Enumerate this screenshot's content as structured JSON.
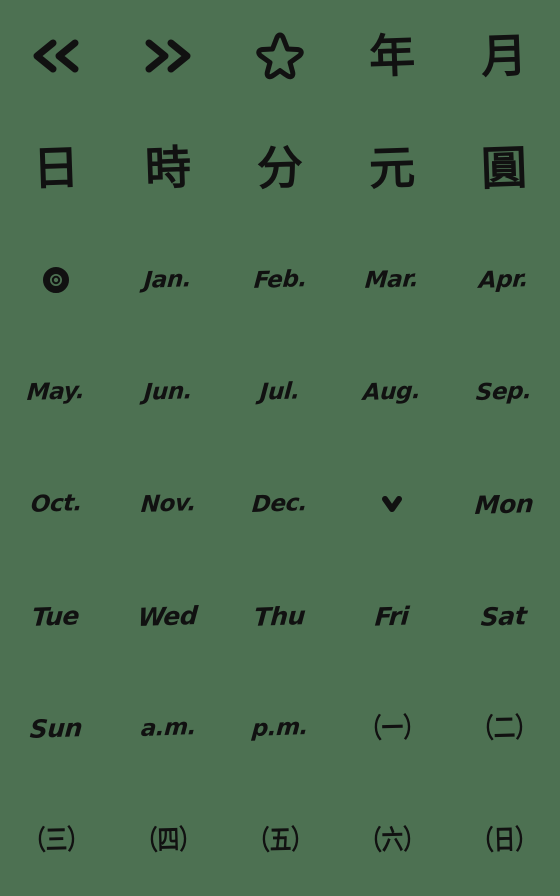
{
  "sheet": {
    "background_color": "#4d7152",
    "ink_color": "#111111",
    "columns": 5,
    "rows": 8
  },
  "items": [
    {
      "name": "double-left-chevron-icon",
      "kind": "icon",
      "icon": "chevron-double-left",
      "label": "<<"
    },
    {
      "name": "double-right-chevron-icon",
      "kind": "icon",
      "icon": "chevron-double-right",
      "label": ">>"
    },
    {
      "name": "star-icon",
      "kind": "icon",
      "icon": "star-outline",
      "label": "☆"
    },
    {
      "name": "kanji-year",
      "kind": "cjk",
      "label": "年"
    },
    {
      "name": "kanji-month",
      "kind": "cjk",
      "label": "月"
    },
    {
      "name": "kanji-day",
      "kind": "cjk",
      "label": "日"
    },
    {
      "name": "kanji-hour",
      "kind": "cjk",
      "label": "時"
    },
    {
      "name": "kanji-minute",
      "kind": "cjk",
      "label": "分"
    },
    {
      "name": "kanji-yuan",
      "kind": "cjk",
      "label": "元"
    },
    {
      "name": "kanji-circled-yen",
      "kind": "cjk",
      "label": "圓"
    },
    {
      "name": "ring-dot-icon",
      "kind": "icon",
      "icon": "ring-dot",
      "label": "◎"
    },
    {
      "name": "month-jan",
      "kind": "latin",
      "label": "Jan."
    },
    {
      "name": "month-feb",
      "kind": "latin",
      "label": "Feb."
    },
    {
      "name": "month-mar",
      "kind": "latin",
      "label": "Mar."
    },
    {
      "name": "month-apr",
      "kind": "latin",
      "label": "Apr."
    },
    {
      "name": "month-may",
      "kind": "latin",
      "label": "May."
    },
    {
      "name": "month-jun",
      "kind": "latin",
      "label": "Jun."
    },
    {
      "name": "month-jul",
      "kind": "latin",
      "label": "Jul."
    },
    {
      "name": "month-aug",
      "kind": "latin",
      "label": "Aug."
    },
    {
      "name": "month-sep",
      "kind": "latin",
      "label": "Sep."
    },
    {
      "name": "month-oct",
      "kind": "latin",
      "label": "Oct."
    },
    {
      "name": "month-nov",
      "kind": "latin",
      "label": "Nov."
    },
    {
      "name": "month-dec",
      "kind": "latin",
      "label": "Dec."
    },
    {
      "name": "chevron-down-icon",
      "kind": "icon",
      "icon": "chevron-down-small",
      "label": "v"
    },
    {
      "name": "weekday-mon",
      "kind": "latin",
      "label": "Mon"
    },
    {
      "name": "weekday-tue",
      "kind": "latin",
      "label": "Tue"
    },
    {
      "name": "weekday-wed",
      "kind": "latin",
      "label": "Wed"
    },
    {
      "name": "weekday-thu",
      "kind": "latin",
      "label": "Thu"
    },
    {
      "name": "weekday-fri",
      "kind": "latin",
      "label": "Fri"
    },
    {
      "name": "weekday-sat",
      "kind": "latin",
      "label": "Sat"
    },
    {
      "name": "weekday-sun",
      "kind": "latin",
      "label": "Sun"
    },
    {
      "name": "time-am",
      "kind": "latin",
      "label": "a.m."
    },
    {
      "name": "time-pm",
      "kind": "latin",
      "label": "p.m."
    },
    {
      "name": "weekday-cjk-one",
      "kind": "paren",
      "label": "（一）"
    },
    {
      "name": "weekday-cjk-two",
      "kind": "paren",
      "label": "（二）"
    },
    {
      "name": "weekday-cjk-three",
      "kind": "paren",
      "label": "（三）"
    },
    {
      "name": "weekday-cjk-four",
      "kind": "paren",
      "label": "（四）"
    },
    {
      "name": "weekday-cjk-five",
      "kind": "paren",
      "label": "（五）"
    },
    {
      "name": "weekday-cjk-six",
      "kind": "paren",
      "label": "（六）"
    },
    {
      "name": "weekday-cjk-sun",
      "kind": "paren",
      "label": "（日）"
    }
  ]
}
